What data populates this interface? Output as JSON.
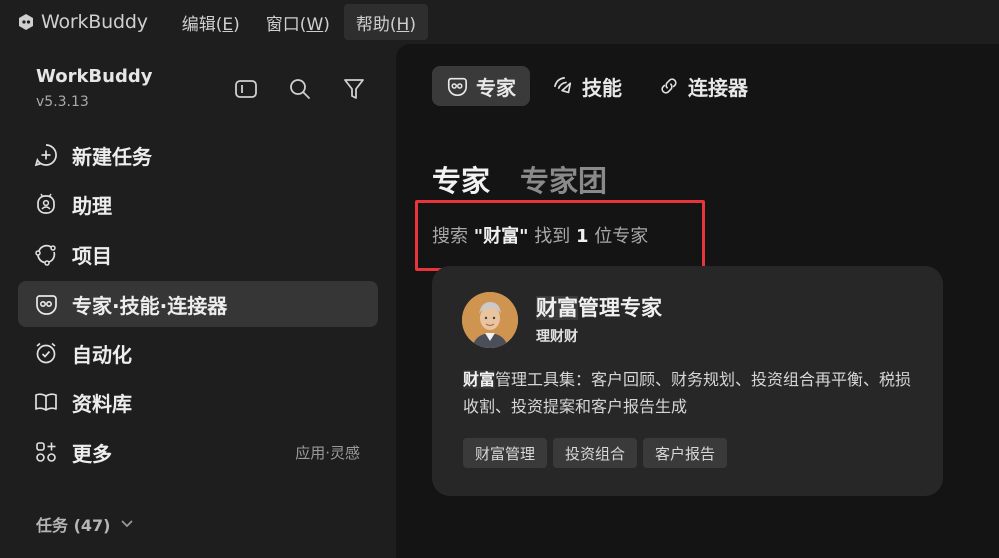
{
  "menubar": {
    "app_name": "WorkBuddy",
    "items": [
      {
        "label": "编辑(E)",
        "active": false
      },
      {
        "label": "窗口(W)",
        "active": false
      },
      {
        "label": "帮助(H)",
        "active": true
      }
    ]
  },
  "sidebar": {
    "workspace_name": "WorkBuddy",
    "version": "v5.3.13",
    "tools": [
      "sidebar-toggle-icon",
      "search-icon",
      "filter-icon"
    ],
    "items": [
      {
        "label": "新建任务",
        "icon": "new-task-icon",
        "active": false
      },
      {
        "label": "助理",
        "icon": "assistant-icon",
        "active": false
      },
      {
        "label": "项目",
        "icon": "project-icon",
        "active": false
      },
      {
        "label": "专家·技能·连接器",
        "icon": "expert-icon",
        "active": true
      },
      {
        "label": "自动化",
        "icon": "automation-icon",
        "active": false
      },
      {
        "label": "资料库",
        "icon": "library-icon",
        "active": false
      },
      {
        "label": "更多",
        "icon": "more-icon",
        "active": false,
        "extra": "应用·灵感"
      }
    ],
    "tasks_label": "任务 (47)"
  },
  "main": {
    "tabs": [
      {
        "label": "专家",
        "icon": "expert-icon",
        "active": true
      },
      {
        "label": "技能",
        "icon": "skill-icon",
        "active": false
      },
      {
        "label": "连接器",
        "icon": "link-icon",
        "active": false
      }
    ],
    "subtabs": [
      {
        "label": "专家",
        "active": true
      },
      {
        "label": "专家团",
        "active": false
      }
    ],
    "search_result": {
      "prefix": "搜索 ",
      "query": "\"财富\"",
      "middle": " 找到 ",
      "count": "1",
      "suffix": " 位专家"
    },
    "highlight_color": "#e8343b",
    "card": {
      "title_highlight": "财富",
      "title_rest": "管理专家",
      "subtitle": "理财财",
      "desc_highlight": "财富",
      "desc_rest": "管理工具集：客户回顾、财务规划、投资组合再平衡、税损收割、投资提案和客户报告生成",
      "tags": [
        "财富管理",
        "投资组合",
        "客户报告"
      ]
    }
  }
}
